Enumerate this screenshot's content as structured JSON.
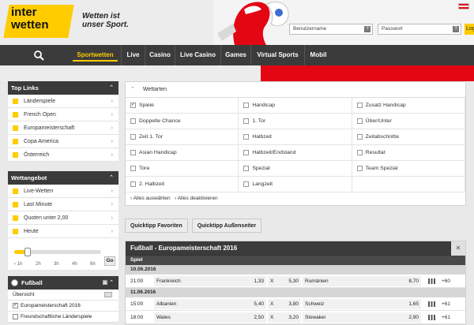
{
  "header": {
    "logo_line1": "inter",
    "logo_line2": "wetten",
    "slogan_line1": "Wetten ist",
    "slogan_line2": "unser Sport.",
    "username_placeholder": "Benutzername",
    "password_placeholder": "Passwort",
    "help_mark": "?",
    "login_label": "Log"
  },
  "nav": {
    "items": [
      "Sportwetten",
      "Live",
      "Casino",
      "Live Casino",
      "Games",
      "Virtual Sports",
      "Mobil"
    ]
  },
  "sidebar": {
    "top_links_title": "Top Links",
    "top_links": [
      "Länderspiele",
      "French Open",
      "Europameisterschaft",
      "Copa America",
      "Österreich"
    ],
    "wettangebot_title": "Wettangebot",
    "wettangebot": [
      "Live-Wetten",
      "Last Minute",
      "Quoten unter 2,00",
      "Heute"
    ],
    "slider_labels": [
      "‹ 1h",
      "2h",
      "3h",
      "4h",
      "6h"
    ],
    "slider_level": 0.15,
    "go_label": "Go",
    "fussball_title": "Fußball",
    "fussball_items": [
      "Übersicht",
      "Europameisterschaft 2016",
      "Freundschaftliche Länderspiele"
    ]
  },
  "wettarten": {
    "title": "Wettarten",
    "options": [
      {
        "label": "Spiele",
        "checked": true
      },
      {
        "label": "Handicap",
        "checked": false
      },
      {
        "label": "Zusatz Handicap",
        "checked": false
      },
      {
        "label": "Doppelte Chance",
        "checked": false
      },
      {
        "label": "1. Tor",
        "checked": false
      },
      {
        "label": "Über/Unter",
        "checked": false
      },
      {
        "label": "Zeit 1. Tor",
        "checked": false
      },
      {
        "label": "Halbzeit",
        "checked": false
      },
      {
        "label": "Zeitabschnitte",
        "checked": false
      },
      {
        "label": "Asian Handicap",
        "checked": false
      },
      {
        "label": "Halbzeit/Endstand",
        "checked": false
      },
      {
        "label": "Resultat",
        "checked": false
      },
      {
        "label": "Tore",
        "checked": false
      },
      {
        "label": "Spezial",
        "checked": false
      },
      {
        "label": "Team Spezial",
        "checked": false
      },
      {
        "label": "2. Halbzeit",
        "checked": false
      },
      {
        "label": "Langzeit",
        "checked": false
      }
    ],
    "select_all": "› Alles auswählen",
    "deselect_all": "› Alles deaktivieren"
  },
  "quicktipp": {
    "favoriten": "Quicktipp Favoriten",
    "aussenseiter": "Quicktipp Außenseiter"
  },
  "matches": {
    "title": "Fußball - Europameisterschaft 2016",
    "close": "✕",
    "column_header": "Spiel",
    "days": [
      {
        "date": "10.06.2016",
        "rows": [
          {
            "time": "21:00",
            "home": "Frankreich",
            "odd1": "1,33",
            "x": "X",
            "oddx": "5,30",
            "away": "Rumänien",
            "odd2": "8,70",
            "more": "+60"
          }
        ]
      },
      {
        "date": "11.06.2016",
        "rows": [
          {
            "time": "15:00",
            "home": "Albanien",
            "odd1": "5,40",
            "x": "X",
            "oddx": "3,80",
            "away": "Schweiz",
            "odd2": "1,65",
            "more": "+61"
          },
          {
            "time": "18:00",
            "home": "Wales",
            "odd1": "2,50",
            "x": "X",
            "oddx": "3,20",
            "away": "Slowakei",
            "odd2": "2,90",
            "more": "+61"
          }
        ]
      }
    ]
  },
  "colors": {
    "brand_yellow": "#ffcc00",
    "nav_dark": "#3b3b3b",
    "austria_red": "#e30613"
  }
}
